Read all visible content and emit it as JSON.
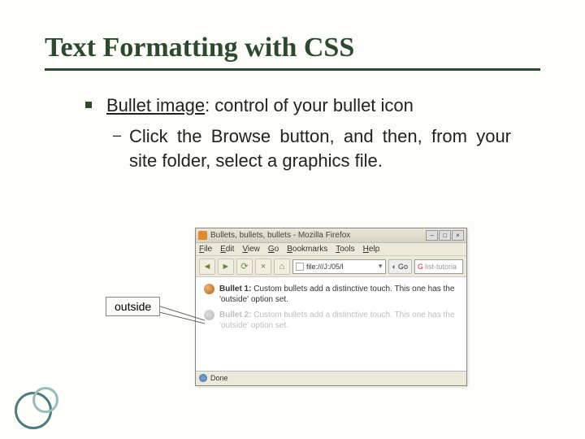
{
  "slide": {
    "title": "Text Formatting with CSS",
    "bullet": {
      "label": "Bullet image",
      "desc": ": control of your bullet icon",
      "sub": "Click the Browse button, and then, from your site folder, select a graphics file."
    },
    "callout_label": "outside"
  },
  "browser": {
    "title": "Bullets, bullets, bullets - Mozilla Firefox",
    "menu": {
      "file": "File",
      "edit": "Edit",
      "view": "View",
      "go": "Go",
      "bookmarks": "Bookmarks",
      "tools": "Tools",
      "help": "Help"
    },
    "address": "file:///J:/05/l",
    "go": "Go",
    "search_placeholder": "list-tutoria",
    "items": [
      {
        "bold": "Bullet 1:",
        "text": " Custom bullets add a distinctive touch. This one has the 'outside' option set."
      },
      {
        "bold": "Bullet 2:",
        "text": " Custom bullets add a distinctive touch. This one has the 'outside' option set."
      }
    ],
    "status": "Done"
  }
}
